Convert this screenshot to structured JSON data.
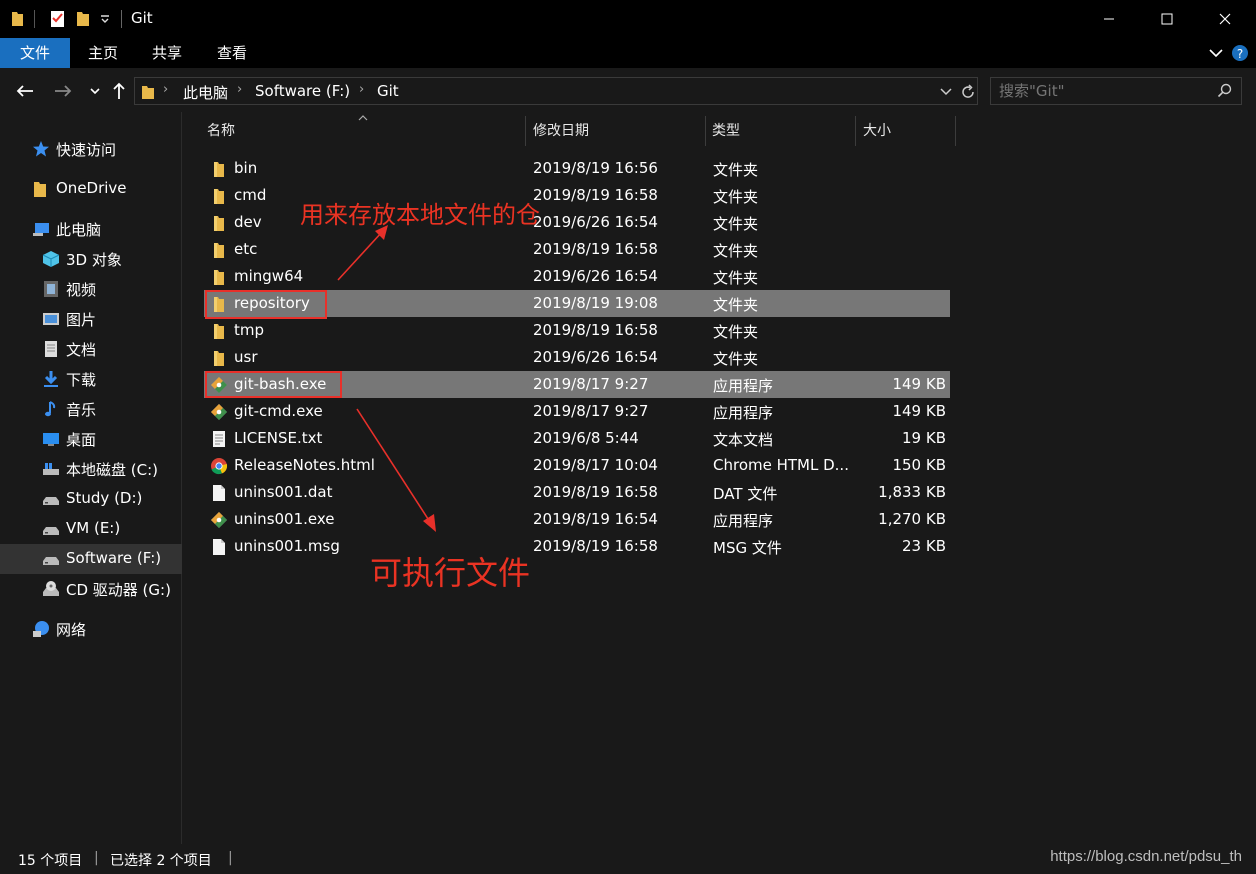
{
  "window": {
    "title": "Git",
    "minimize": "minimize",
    "maximize": "maximize",
    "close": "close"
  },
  "ribbon": {
    "tabs": [
      {
        "label": "文件",
        "active": true
      },
      {
        "label": "主页",
        "active": false
      },
      {
        "label": "共享",
        "active": false
      },
      {
        "label": "查看",
        "active": false
      }
    ]
  },
  "address": {
    "crumbs": [
      "此电脑",
      "Software (F:)",
      "Git"
    ],
    "search_placeholder": "搜索\"Git\""
  },
  "sidebar": {
    "items": [
      {
        "label": "快速访问",
        "icon": "star-icon"
      },
      {
        "label": "OneDrive",
        "icon": "folder-icon"
      },
      {
        "label": "此电脑",
        "icon": "computer-icon"
      },
      {
        "label": "3D 对象",
        "icon": "3d-objects-icon"
      },
      {
        "label": "视频",
        "icon": "video-icon"
      },
      {
        "label": "图片",
        "icon": "pictures-icon"
      },
      {
        "label": "文档",
        "icon": "documents-icon"
      },
      {
        "label": "下载",
        "icon": "download-icon"
      },
      {
        "label": "音乐",
        "icon": "music-icon"
      },
      {
        "label": "桌面",
        "icon": "desktop-icon"
      },
      {
        "label": "本地磁盘 (C:)",
        "icon": "system-drive-icon"
      },
      {
        "label": "Study (D:)",
        "icon": "drive-icon"
      },
      {
        "label": "VM (E:)",
        "icon": "drive-icon"
      },
      {
        "label": "Software  (F:)",
        "icon": "drive-icon",
        "selected": true
      },
      {
        "label": "CD 驱动器 (G:)",
        "icon": "cd-drive-icon"
      },
      {
        "label": "网络",
        "icon": "network-icon"
      }
    ]
  },
  "columns": {
    "name": "名称",
    "date": "修改日期",
    "type": "类型",
    "size": "大小"
  },
  "files": [
    {
      "name": "bin",
      "date": "2019/8/19 16:56",
      "type": "文件夹",
      "size": "",
      "icon": "folder-icon"
    },
    {
      "name": "cmd",
      "date": "2019/8/19 16:58",
      "type": "文件夹",
      "size": "",
      "icon": "folder-icon"
    },
    {
      "name": "dev",
      "date": "2019/6/26 16:54",
      "type": "文件夹",
      "size": "",
      "icon": "folder-icon"
    },
    {
      "name": "etc",
      "date": "2019/8/19 16:58",
      "type": "文件夹",
      "size": "",
      "icon": "folder-icon"
    },
    {
      "name": "mingw64",
      "date": "2019/6/26 16:54",
      "type": "文件夹",
      "size": "",
      "icon": "folder-icon"
    },
    {
      "name": "repository",
      "date": "2019/8/19 19:08",
      "type": "文件夹",
      "size": "",
      "icon": "folder-icon",
      "selected": true
    },
    {
      "name": "tmp",
      "date": "2019/8/19 16:58",
      "type": "文件夹",
      "size": "",
      "icon": "folder-icon"
    },
    {
      "name": "usr",
      "date": "2019/6/26 16:54",
      "type": "文件夹",
      "size": "",
      "icon": "folder-icon"
    },
    {
      "name": "git-bash.exe",
      "date": "2019/8/17 9:27",
      "type": "应用程序",
      "size": "149 KB",
      "icon": "git-icon",
      "selected": true
    },
    {
      "name": "git-cmd.exe",
      "date": "2019/8/17 9:27",
      "type": "应用程序",
      "size": "149 KB",
      "icon": "git-icon"
    },
    {
      "name": "LICENSE.txt",
      "date": "2019/6/8 5:44",
      "type": "文本文档",
      "size": "19 KB",
      "icon": "text-file-icon"
    },
    {
      "name": "ReleaseNotes.html",
      "date": "2019/8/17 10:04",
      "type": "Chrome HTML D...",
      "size": "150 KB",
      "icon": "chrome-icon"
    },
    {
      "name": "unins001.dat",
      "date": "2019/8/19 16:58",
      "type": "DAT 文件",
      "size": "1,833 KB",
      "icon": "file-icon"
    },
    {
      "name": "unins001.exe",
      "date": "2019/8/19 16:54",
      "type": "应用程序",
      "size": "1,270 KB",
      "icon": "git-icon"
    },
    {
      "name": "unins001.msg",
      "date": "2019/8/19 16:58",
      "type": "MSG 文件",
      "size": "23 KB",
      "icon": "file-icon"
    }
  ],
  "annotations": {
    "repo_note": "用来存放本地文件的仓",
    "exe_note": "可执行文件"
  },
  "status": {
    "count": "15 个项目",
    "selected": "已选择 2 个项目",
    "watermark": "https://blog.csdn.net/pdsu_th"
  },
  "colors": {
    "accent": "#1a6fbf",
    "selection": "#777777",
    "annotation": "#e8302a",
    "folder": "#e8b84a"
  }
}
